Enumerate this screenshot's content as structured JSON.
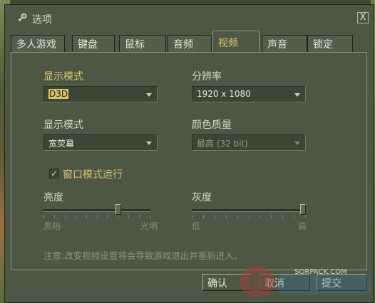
{
  "window": {
    "title": "选项",
    "close_label": "X"
  },
  "tabs": [
    {
      "label": "多人游戏"
    },
    {
      "label": "键盘"
    },
    {
      "label": "鼠标"
    },
    {
      "label": "音频"
    },
    {
      "label": "视频",
      "active": true
    },
    {
      "label": "声音"
    },
    {
      "label": "锁定"
    }
  ],
  "video": {
    "display_mode_label": "显示模式",
    "display_mode_value": "D3D",
    "resolution_label": "分辨率",
    "resolution_value": "1920 x 1080",
    "aspect_label": "显示模式",
    "aspect_value": "宽荧幕",
    "color_quality_label": "颜色质量",
    "color_quality_value": "最高 (32 bit)",
    "windowed_label": "窗口模式运行",
    "windowed_checked": true,
    "brightness_label": "亮度",
    "brightness_min": "黑暗",
    "brightness_max": "光明",
    "brightness_level": 0.71,
    "gamma_label": "灰度",
    "gamma_min": "低",
    "gamma_max": "高",
    "gamma_level": 1.0,
    "note": "注意:改变视频设置将会导致游戏退出并重新进入。"
  },
  "buttons": {
    "ok": "确认",
    "cancel": "取消",
    "apply": "提交"
  },
  "watermark": {
    "text": "SORPACK.COM"
  },
  "colors": {
    "accent": "#d9c46a",
    "window_bg": "#4c5844",
    "border": "#8f9785"
  }
}
